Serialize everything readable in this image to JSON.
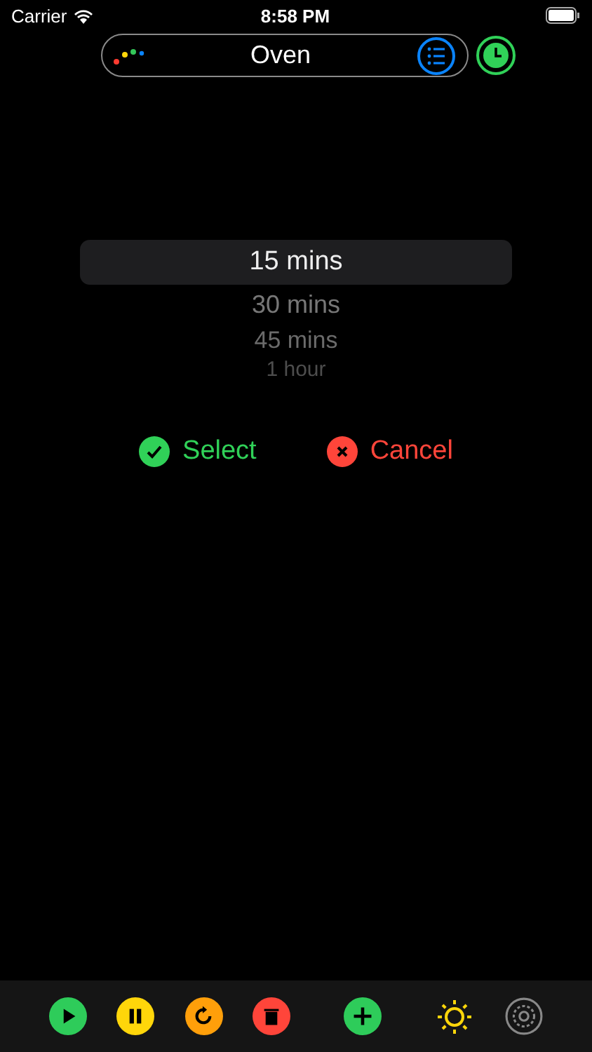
{
  "status_bar": {
    "carrier": "Carrier",
    "time": "8:58 PM"
  },
  "header": {
    "title": "Oven"
  },
  "picker": {
    "items": [
      {
        "label": "15 mins",
        "selected": true
      },
      {
        "label": "30 mins",
        "selected": false
      },
      {
        "label": "45 mins",
        "selected": false
      },
      {
        "label": "1 hour",
        "selected": false
      }
    ]
  },
  "actions": [
    {
      "kind": "confirm",
      "label": "Select"
    },
    {
      "kind": "cancel",
      "label": "Cancel"
    }
  ],
  "toolbar": [
    {
      "kind": "play"
    },
    {
      "kind": "pause"
    },
    {
      "kind": "restart"
    },
    {
      "kind": "delete"
    },
    {
      "kind": "add"
    },
    {
      "kind": "brightness"
    },
    {
      "kind": "settings"
    }
  ]
}
